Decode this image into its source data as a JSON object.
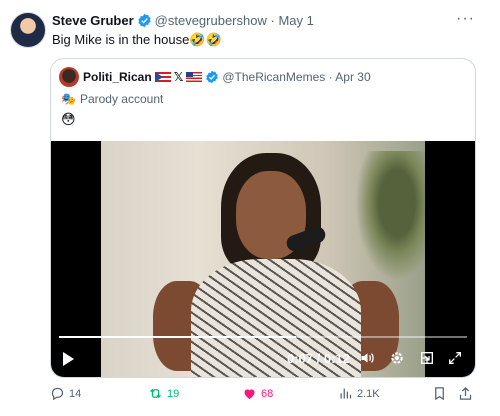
{
  "tweet": {
    "author_name": "Steve Gruber",
    "handle": "@stevegrubershow",
    "separator": "·",
    "date": "May 1",
    "more": "···",
    "text": "Big Mike is in the house🤣🤣"
  },
  "quote": {
    "author_name": "Politi_Rican",
    "name_suffix": "𝕏",
    "handle": "@TheRicanMemes",
    "separator": "·",
    "date": "Apr 30",
    "parody_label": "Parody account",
    "parody_icon": "🎭",
    "emoji": "😳"
  },
  "video": {
    "time_display": "0:07 / 0:12",
    "progress_fraction": 0.58
  },
  "actions": {
    "replies": "14",
    "reposts": "19",
    "likes": "68",
    "views": "2.1K"
  },
  "colors": {
    "verified": "#1d9bf0",
    "repost": "#00ba7c",
    "like": "#f91880",
    "secondary_text": "#536471"
  }
}
